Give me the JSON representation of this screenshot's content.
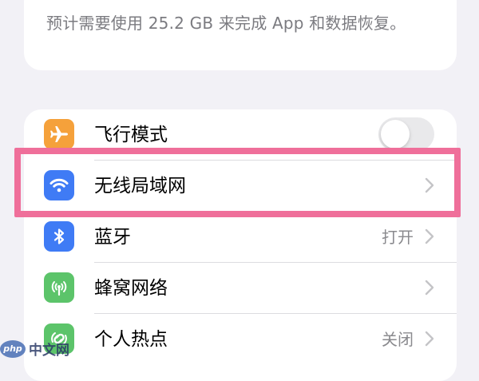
{
  "info": {
    "text": "预计需要使用 25.2 GB 来完成 App 和数据恢复。"
  },
  "settings": {
    "rows": [
      {
        "label": "飞行模式",
        "icon": "airplane-icon",
        "color": "#f5a13b",
        "toggle": false
      },
      {
        "label": "无线局域网",
        "icon": "wifi-icon",
        "color": "#3f7bf5",
        "value": ""
      },
      {
        "label": "蓝牙",
        "icon": "bluetooth-icon",
        "color": "#3f7bf5",
        "value": "打开"
      },
      {
        "label": "蜂窝网络",
        "icon": "cellular-icon",
        "color": "#5cc46a",
        "value": ""
      },
      {
        "label": "个人热点",
        "icon": "hotspot-icon",
        "color": "#5cc46a",
        "value": "关闭"
      }
    ]
  },
  "highlight": {
    "color": "#ef6f9a"
  },
  "watermark": {
    "logo_text": "php",
    "text": "中文网"
  }
}
